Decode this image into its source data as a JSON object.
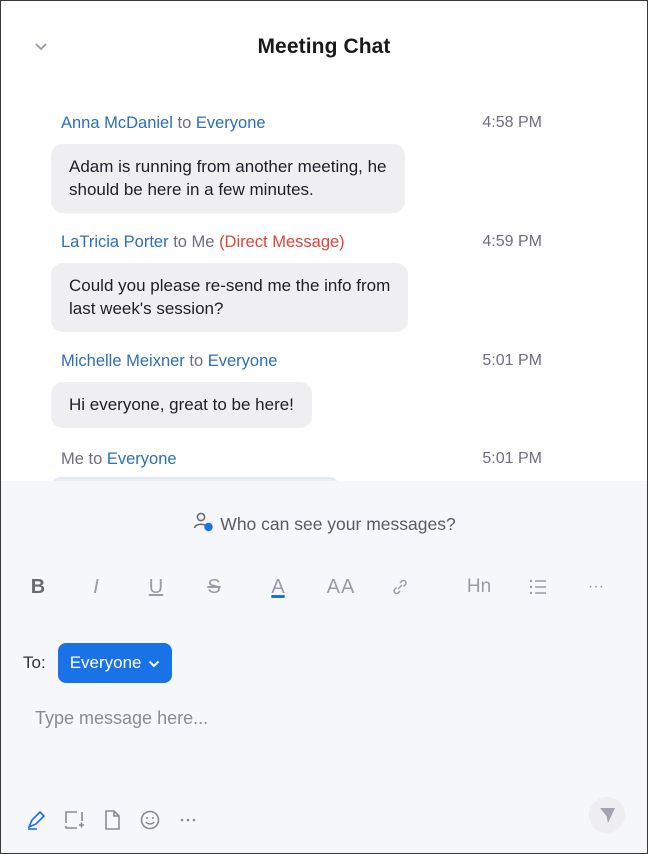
{
  "header": {
    "title": "Meeting Chat",
    "collapse_icon": "chevron-down-icon"
  },
  "messages": [
    {
      "sender": "Anna McDaniel",
      "to_word": "to",
      "recipient": "Everyone",
      "direct_label": "",
      "time": "4:58 PM",
      "text_lines": [
        "Adam is running from another meeting, he",
        "should be here in a few minutes."
      ]
    },
    {
      "sender": "LaTricia Porter",
      "to_word": "to",
      "recipient": "Me",
      "direct_label": "(Direct Message)",
      "time": "4:59 PM",
      "text_lines": [
        "Could you please re-send me the info from",
        "last week's session?"
      ]
    },
    {
      "sender": "Michelle Meixner",
      "to_word": "to",
      "recipient": "Everyone",
      "direct_label": "",
      "time": "5:01 PM",
      "text_lines": [
        "Hi everyone, great to be here!"
      ]
    },
    {
      "sender": "Me",
      "to_word": "to",
      "recipient": "Everyone",
      "direct_label": "",
      "time": "5:01 PM",
      "text_lines": []
    }
  ],
  "composer": {
    "visibility_text": "Who can see your messages?",
    "toolbar": {
      "bold": "B",
      "italic": "I",
      "underline": "U",
      "strikethrough": "S",
      "font_color": "A",
      "font_size": "AA",
      "link_icon": "link-icon",
      "heading": "Hn",
      "list_icon": "bulleted-list-icon",
      "more": "···"
    },
    "to_label": "To:",
    "audience": "Everyone",
    "input_placeholder": "Type message here...",
    "bottom_icons": [
      "format-pen-icon",
      "screenshot-icon",
      "file-icon",
      "emoji-icon",
      "more-icon"
    ],
    "send_icon": "send-icon"
  },
  "colors": {
    "accent": "#1a72e8",
    "sender_blue": "#2d6fb8",
    "direct_message_red": "#e0443a",
    "bubble_bg": "#efeff2"
  }
}
